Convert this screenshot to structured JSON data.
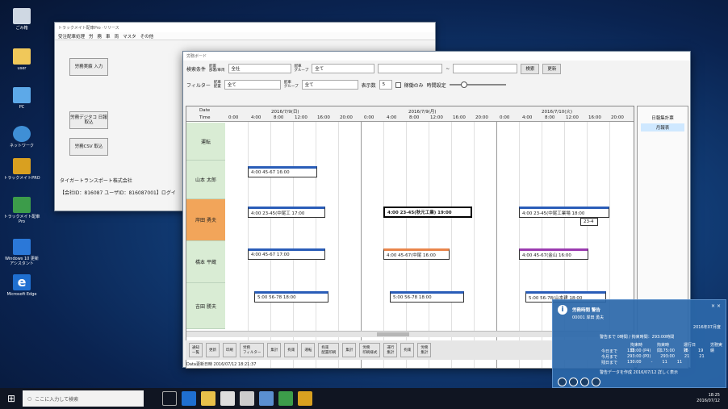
{
  "desktop_icons": [
    {
      "label": "ごみ箱",
      "icon": "recycle-bin-icon"
    },
    {
      "label": "user",
      "icon": "user-folder-icon"
    },
    {
      "label": "PC",
      "icon": "pc-icon"
    },
    {
      "label": "ネットワーク",
      "icon": "network-icon"
    },
    {
      "label": "トラックメイトPRO",
      "icon": "truckmate-icon"
    },
    {
      "label": "トラックメイト配車 Pro",
      "icon": "dispatch-app-icon"
    },
    {
      "label": "Windows 10 更新 アシスタント",
      "icon": "windows-update-icon"
    },
    {
      "label": "Microsoft Edge",
      "icon": "edge-icon"
    }
  ],
  "back_window": {
    "title": "トラックメイト配車Pro ·リリース",
    "menu": [
      "受注配車処理",
      "労",
      "務",
      "車",
      "両",
      "マスタ",
      "その他"
    ],
    "buttons": [
      "労務実績\n入力",
      "労務デジタコ\n日報取込",
      "労務CSV\n取込"
    ],
    "company": "タイガートランスポート株式会社",
    "user_line": "【会社ID：816087 ユーザID：816087001】ログイ"
  },
  "main_window": {
    "title": "労務ボード",
    "row1": {
      "label": "検索条件",
      "field1_label": "配置\n部署/車両",
      "field1_value": "全社",
      "field2_label": "配車\nグループ",
      "field2_value": "全て",
      "search": "検索",
      "update": "更新"
    },
    "row2": {
      "label": "フィルター",
      "f1_label": "配車\n配置",
      "f1_value": "全て",
      "f2_label": "配車\nグループ",
      "f2_value": "全て",
      "display_count_label": "表示数",
      "display_count": "5",
      "checkbox_label": "稼働のみ",
      "time_label": "時間設定"
    },
    "dates": [
      "2016/7/9(日)",
      "2016/7/9(月)",
      "2016/7/10(火)"
    ],
    "times": [
      "0:00",
      "4:00",
      "8:00",
      "12:00",
      "16:00",
      "20:00"
    ],
    "header_date": "Date",
    "header_time": "Time",
    "drivers": [
      "運転",
      "山本 太郎",
      "岸田 勇夫",
      "橋本 平蔵",
      "吉田 勝夫"
    ],
    "bars": [
      {
        "text": "4:00   45-67   16:00"
      },
      {
        "text": "4:00  23-45(中尾工  17:00"
      },
      {
        "text": "4:00  23-45(秋元工業)  19:00"
      },
      {
        "text": "4:00  23-45(中尾工業場  18:00"
      },
      {
        "text": "23-4"
      },
      {
        "text": "4:00   45-67   17:00"
      },
      {
        "text": "4:00  45-67(中尾  16:00"
      },
      {
        "text": "4:00  45-67(金山  16:00"
      },
      {
        "text": "5:00   56-78   18:00"
      },
      {
        "text": "5:00   56-78   18:00"
      },
      {
        "text": "5:00  56-78(山本建  18:00"
      }
    ],
    "right_panel": {
      "title": "日報集計票",
      "button": "月報表"
    },
    "bottom_buttons": [
      "通知\n一覧",
      "更新",
      "印刷",
      "労務\nフィルター",
      "集計",
      "拘束",
      "運転",
      "拘束\n配置印刷",
      "集計",
      "労務\n印刷様式",
      "運行\n集計",
      "拘束",
      "労務\n集計"
    ],
    "status": "Data更新日時  2016/07/12  18:21:37"
  },
  "toast": {
    "app": "労務時間 警告",
    "user": "00001  岸田 勇夫",
    "month": "2016年07月度",
    "line1": "警告まで  0時間 / 拘束時間：293:00時間",
    "col_headers": [
      "拘束時間",
      "拘束時間",
      "運行日数",
      "労務実績"
    ],
    "rows": [
      [
        "今日まで",
        "133:00 (P4)",
        "175:00",
        "-5",
        "19"
      ],
      [
        "今月まで",
        "293:00 (P0)",
        "293:00",
        "21",
        "21"
      ],
      [
        "残日まで",
        "130:00",
        "-",
        "11",
        "11"
      ]
    ],
    "footer": "警告データを作成  2016/07/12  詳しく表示"
  },
  "taskbar": {
    "search_placeholder": "ここに入力して検索",
    "clock_time": "18:25",
    "clock_date": "2016/07/12"
  },
  "colors": {
    "accent_blue": "#2a5db8",
    "driver_green": "#d9ecd4",
    "driver_highlight": "#f2a55a",
    "desktop": "#123f7a"
  }
}
